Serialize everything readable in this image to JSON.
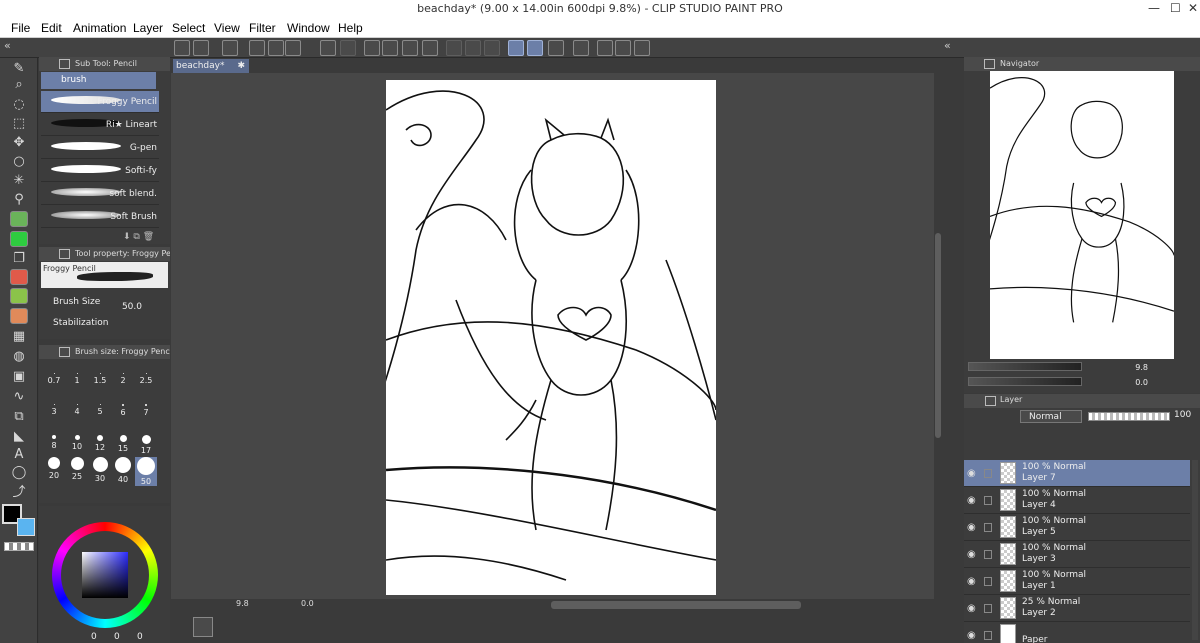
{
  "window": {
    "title": "beachday* (9.00 x 14.00in 600dpi 9.8%) - CLIP STUDIO PAINT PRO",
    "minimize": "—",
    "maximize": "☐",
    "close": "✕"
  },
  "menu": [
    "File",
    "Edit",
    "Animation",
    "Layer",
    "Select",
    "View",
    "Filter",
    "Window",
    "Help"
  ],
  "subtool": {
    "title": "Sub Tool: Pencil",
    "group": "brush",
    "items": [
      {
        "name": "Froggy Pencil",
        "active": true
      },
      {
        "name": "Ri★ Lineart",
        "active": false
      },
      {
        "name": "G-pen",
        "active": false
      },
      {
        "name": "Softi-fy",
        "active": false
      },
      {
        "name": "soft blend.",
        "active": false
      },
      {
        "name": "Soft Brush",
        "active": false
      }
    ]
  },
  "toolprop": {
    "title": "Tool property: Froggy Penc",
    "preview_name": "Froggy Pencil",
    "brush_size_label": "Brush Size",
    "brush_size_value": "50.0",
    "stabilization_label": "Stabilization"
  },
  "brushsize": {
    "title": "Brush size: Froggy Pencil",
    "rows": [
      [
        "0.7",
        "1",
        "1.5",
        "2",
        "2.5"
      ],
      [
        "3",
        "4",
        "5",
        "6",
        "7"
      ],
      [
        "8",
        "10",
        "12",
        "15",
        "17"
      ],
      [
        "20",
        "25",
        "30",
        "40",
        "50"
      ]
    ],
    "active": "50"
  },
  "colorwheel": {
    "readout": [
      "0",
      "0",
      "0"
    ]
  },
  "document": {
    "tab": "beachday*",
    "zoom": "9.8",
    "rotation": "0.0"
  },
  "navigator": {
    "title": "Navigator",
    "zoom": "9.8",
    "rotation": "0.0"
  },
  "layers": {
    "title": "Layer",
    "blend_mode": "Normal",
    "opacity": "100",
    "rows": [
      {
        "line1": "100 % Normal",
        "line2": "Layer 7",
        "active": true
      },
      {
        "line1": "100 % Normal",
        "line2": "Layer 4",
        "active": false
      },
      {
        "line1": "100 % Normal",
        "line2": "Layer 5",
        "active": false
      },
      {
        "line1": "100 % Normal",
        "line2": "Layer 3",
        "active": false
      },
      {
        "line1": "100 % Normal",
        "line2": "Layer 1",
        "active": false
      },
      {
        "line1": "25 % Normal",
        "line2": "Layer 2",
        "active": false
      },
      {
        "line1": "",
        "line2": "Paper",
        "active": false
      }
    ]
  },
  "colors": {
    "accent": "#6c7fa8",
    "panel": "#3c3c3c",
    "main_color": "#000000",
    "sub_color": "#5ab4f0"
  }
}
